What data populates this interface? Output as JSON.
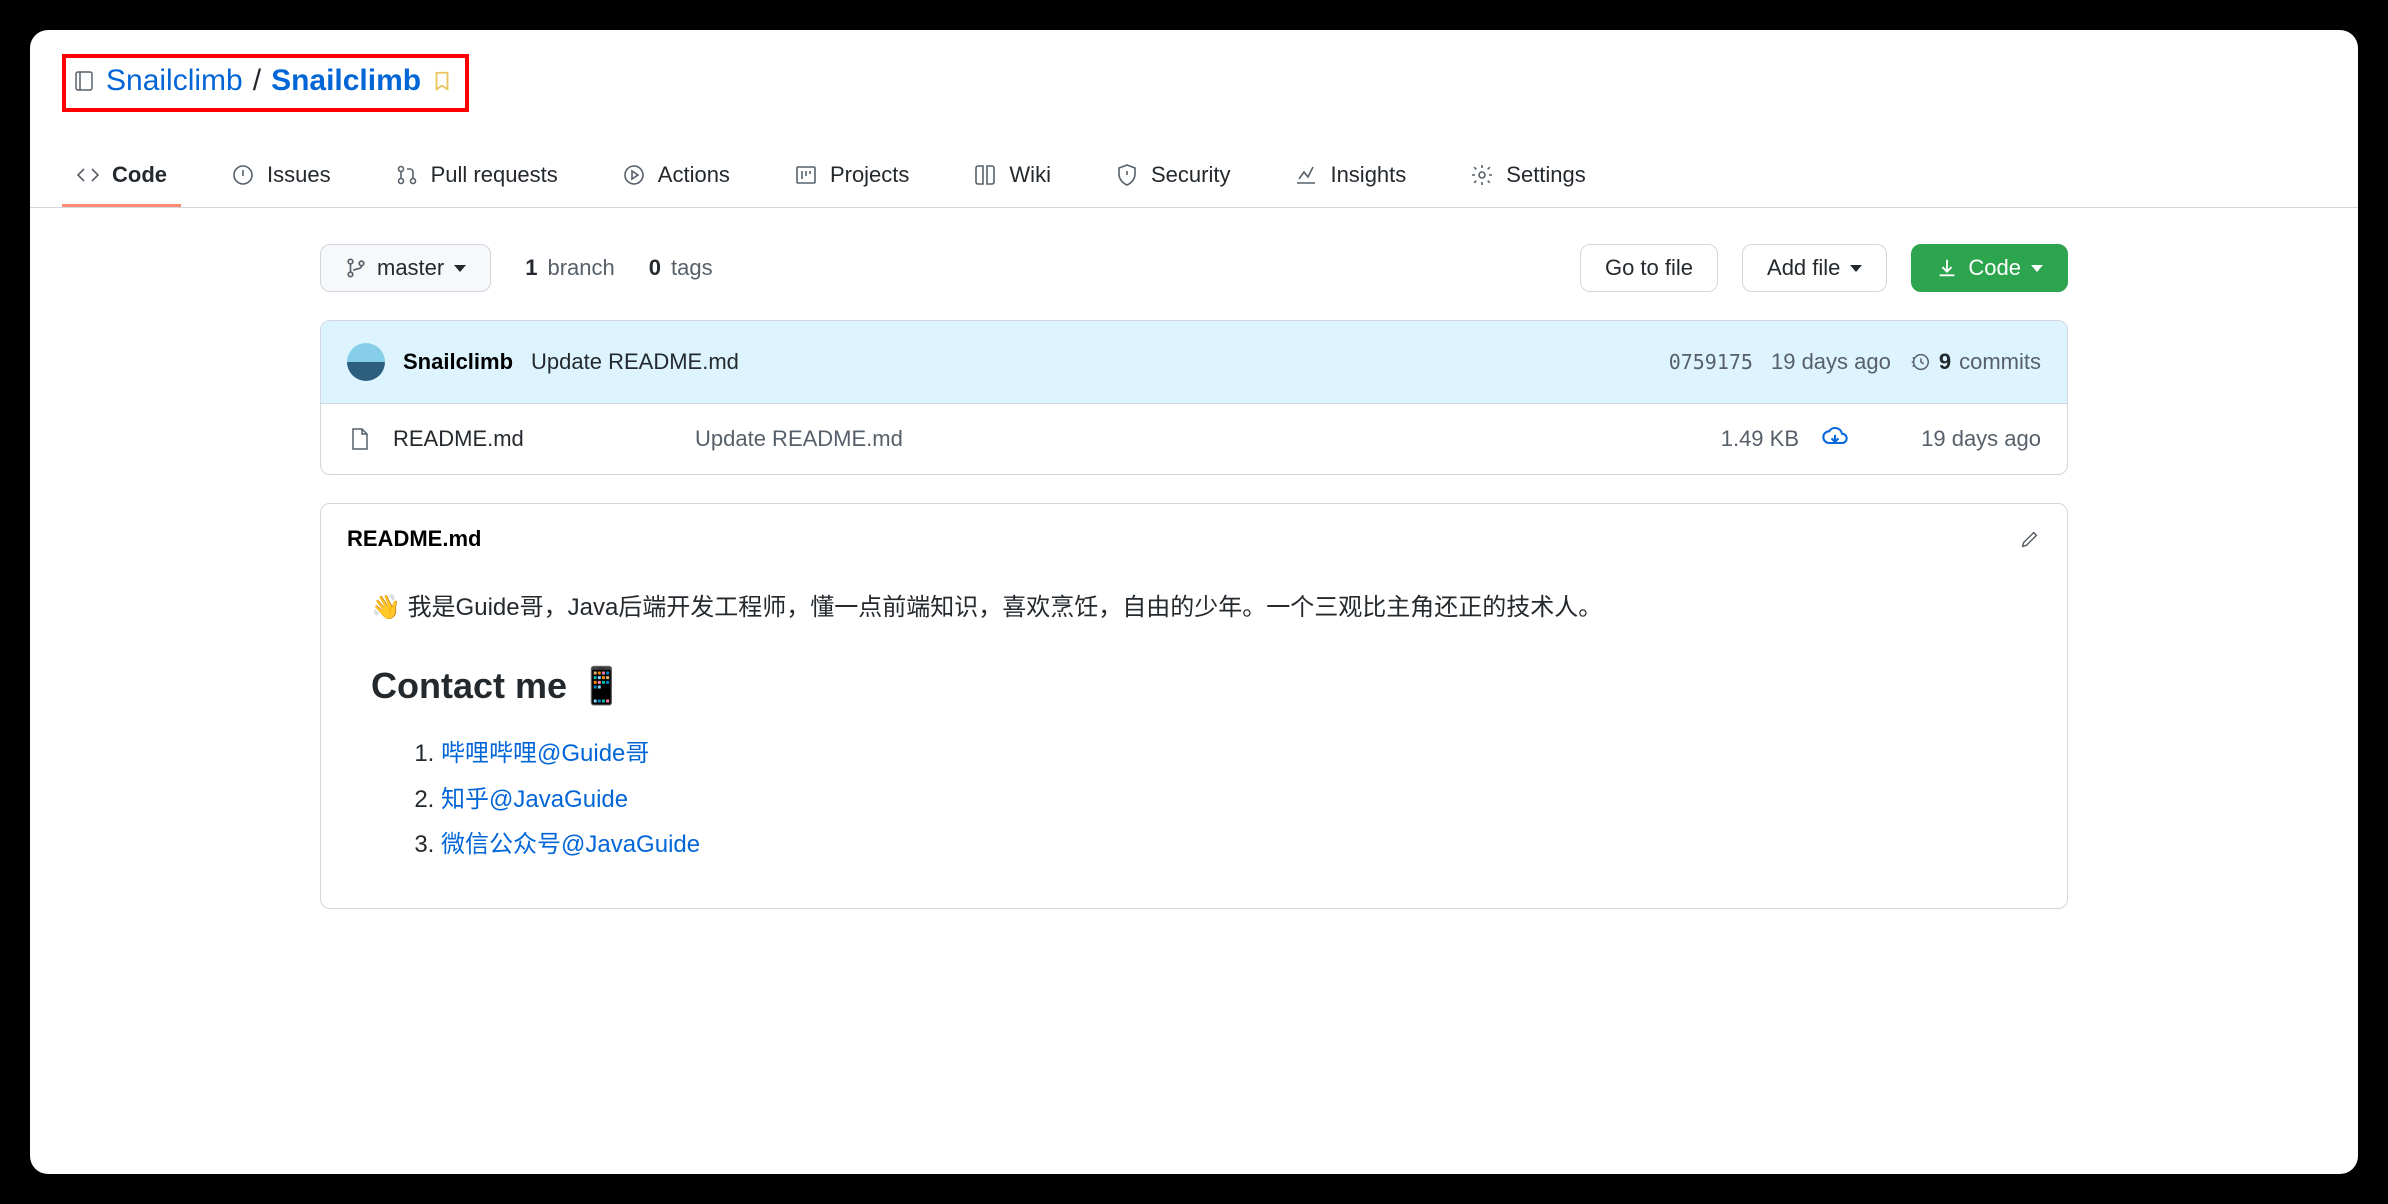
{
  "breadcrumb": {
    "owner": "Snailclimb",
    "sep": "/",
    "repo": "Snailclimb"
  },
  "tabs": [
    {
      "label": "Code"
    },
    {
      "label": "Issues"
    },
    {
      "label": "Pull requests"
    },
    {
      "label": "Actions"
    },
    {
      "label": "Projects"
    },
    {
      "label": "Wiki"
    },
    {
      "label": "Security"
    },
    {
      "label": "Insights"
    },
    {
      "label": "Settings"
    }
  ],
  "toolbar": {
    "branch": "master",
    "branch_count": "1",
    "branch_label": "branch",
    "tag_count": "0",
    "tag_label": "tags",
    "goto_file": "Go to file",
    "add_file": "Add file",
    "code": "Code"
  },
  "commit": {
    "author": "Snailclimb",
    "message": "Update README.md",
    "sha": "0759175",
    "ago": "19 days ago",
    "count": "9",
    "count_label": "commits"
  },
  "files": [
    {
      "name": "README.md",
      "msg": "Update README.md",
      "size": "1.49 KB",
      "ago": "19 days ago"
    }
  ],
  "readme": {
    "title": "README.md",
    "intro_emoji": "👋",
    "intro": "我是Guide哥，Java后端开发工程师，懂一点前端知识，喜欢烹饪，自由的少年。一个三观比主角还正的技术人。",
    "contact_heading": "Contact me",
    "contact_emoji": "📱",
    "links": [
      {
        "label": "哔哩哔哩@Guide哥"
      },
      {
        "label": "知乎@JavaGuide"
      },
      {
        "label": "微信公众号@JavaGuide"
      }
    ]
  }
}
